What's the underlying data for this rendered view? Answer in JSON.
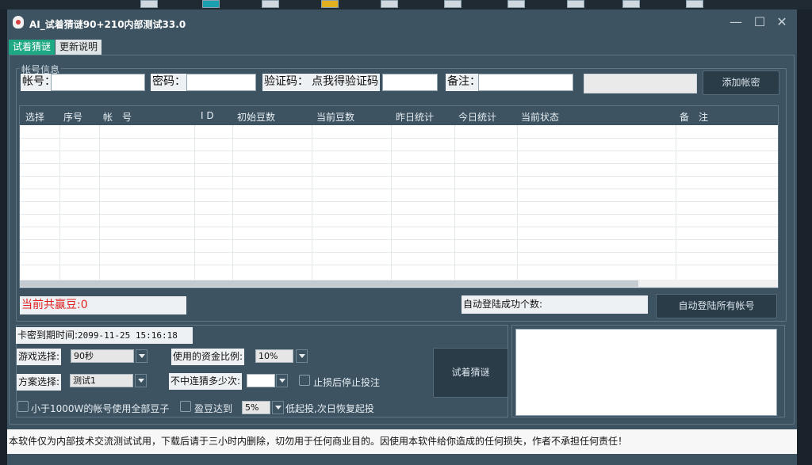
{
  "window": {
    "title": "AI_试着猜谜90+210内部测试33.0",
    "controls": {
      "minimize": "—",
      "maximize": "☐",
      "close": "✕"
    }
  },
  "tabs": [
    {
      "label": "试着猜谜",
      "active": true
    },
    {
      "label": "更新说明",
      "active": false
    }
  ],
  "account_group": {
    "title": "帐号信息",
    "fields": {
      "account_label": "帐号：",
      "password_label": "密码：",
      "captcha_label": "验证码：",
      "get_captcha_label": "点我得验证码",
      "note_label": "备注："
    },
    "add_button": "添加帐密"
  },
  "table": {
    "columns": [
      "选择",
      "序号",
      "帐　号",
      "I D",
      "初始豆数",
      "当前豆数",
      "昨日统计",
      "今日统计",
      "当前状态",
      "备　注"
    ],
    "rows": []
  },
  "status": {
    "total_won": "当前共赢豆:0",
    "auto_login_count": "自动登陆成功个数:",
    "auto_login_button": "自动登陆所有帐号"
  },
  "settings": {
    "expire_label": "卡密到期时间:",
    "expire_value": "2099-11-25 15:16:18",
    "game_label": "游戏选择:",
    "game_value": "90秒",
    "fund_ratio_label": "使用的资金比例:",
    "fund_ratio_value": "10%",
    "plan_label": "方案选择:",
    "plan_value": "测试1",
    "miss_label": "不中连猜多少次:",
    "miss_value": "",
    "stoploss_label": "止损后停止投注",
    "under_label": "小于1000W的帐号使用全部豆子",
    "profit_label": "盈豆达到",
    "profit_value": "5%",
    "profit_suffix": "低起投,次日恢复起投",
    "start_button": "试着猜谜"
  },
  "footer": {
    "disclaimer": "本软件仅为内部技术交流测试试用，下载后请于三小时内删除，切勿用于任何商业目的。因使用本软件给你造成的任何损失，作者不承担任何责任！"
  }
}
